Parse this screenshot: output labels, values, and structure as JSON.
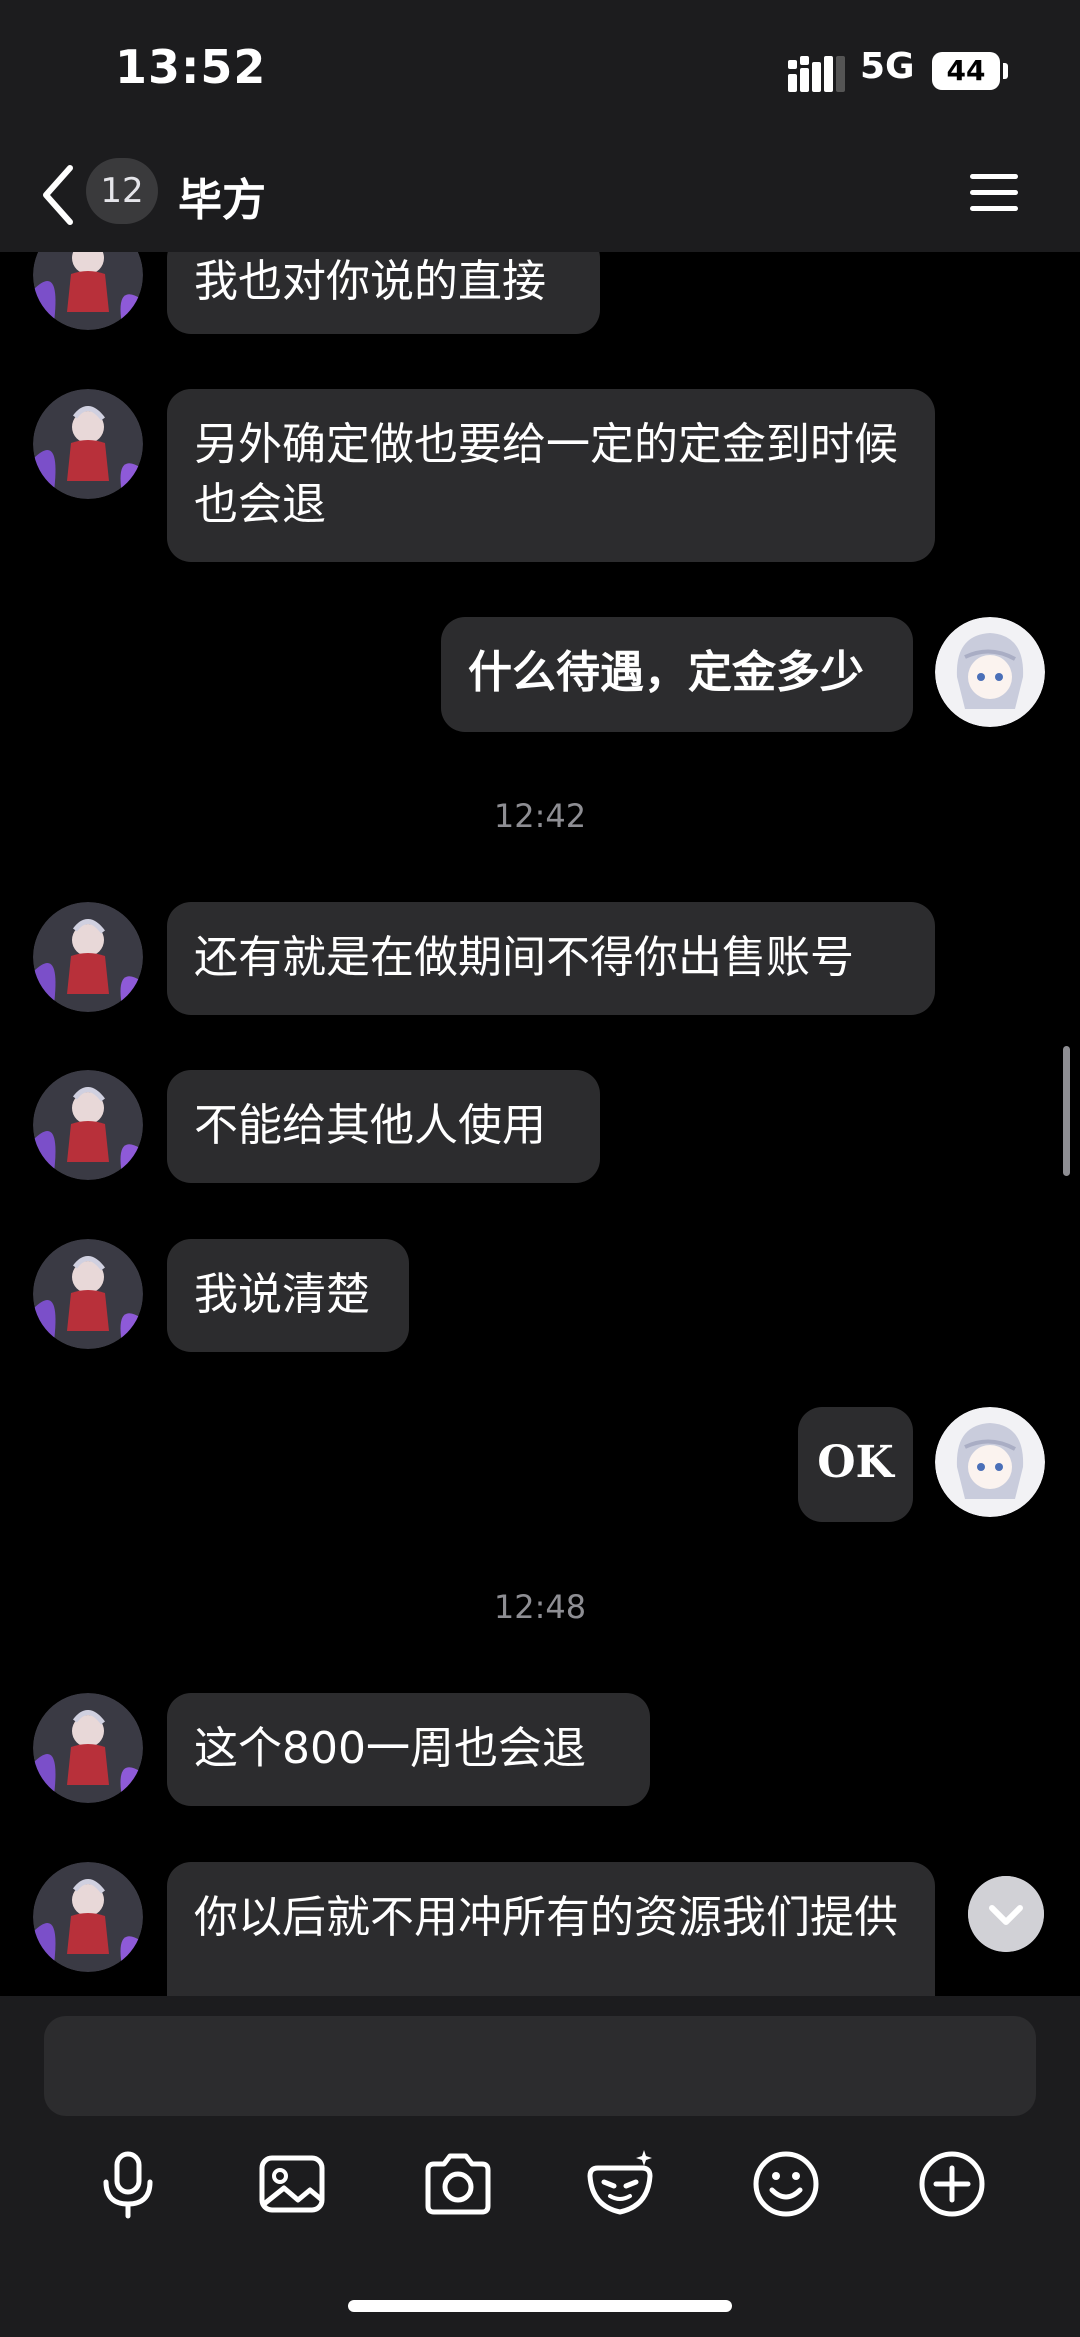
{
  "status": {
    "time": "13:52",
    "network": "5G",
    "battery": "44"
  },
  "nav": {
    "unread_count": "12",
    "title": "毕方"
  },
  "messages": [
    {
      "sender": "other",
      "text": "我也对你说的直接"
    },
    {
      "sender": "other",
      "text": "另外确定做也要给一定的定金到时候也会退"
    },
    {
      "sender": "me",
      "text": "什么待遇，定金多少"
    },
    {
      "timestamp": "12:42"
    },
    {
      "sender": "other",
      "text": "还有就是在做期间不得你出售账号"
    },
    {
      "sender": "other",
      "text": "不能给其他人使用"
    },
    {
      "sender": "other",
      "text": "我说清楚"
    },
    {
      "sender": "me",
      "text": "OK"
    },
    {
      "timestamp": "12:48"
    },
    {
      "sender": "other",
      "text": "这个800一周也会退"
    },
    {
      "sender": "other",
      "text": "你以后就不用冲所有的资源我们提供"
    }
  ],
  "input": {
    "placeholder": ""
  },
  "toolbar": [
    "microphone-icon",
    "image-icon",
    "camera-icon",
    "sticker-icon",
    "emoji-icon",
    "plus-icon"
  ],
  "colors": {
    "background": "#000000",
    "bar": "#1c1c1e",
    "bubble": "#2c2c2e",
    "timestamp": "#8e8e93"
  }
}
